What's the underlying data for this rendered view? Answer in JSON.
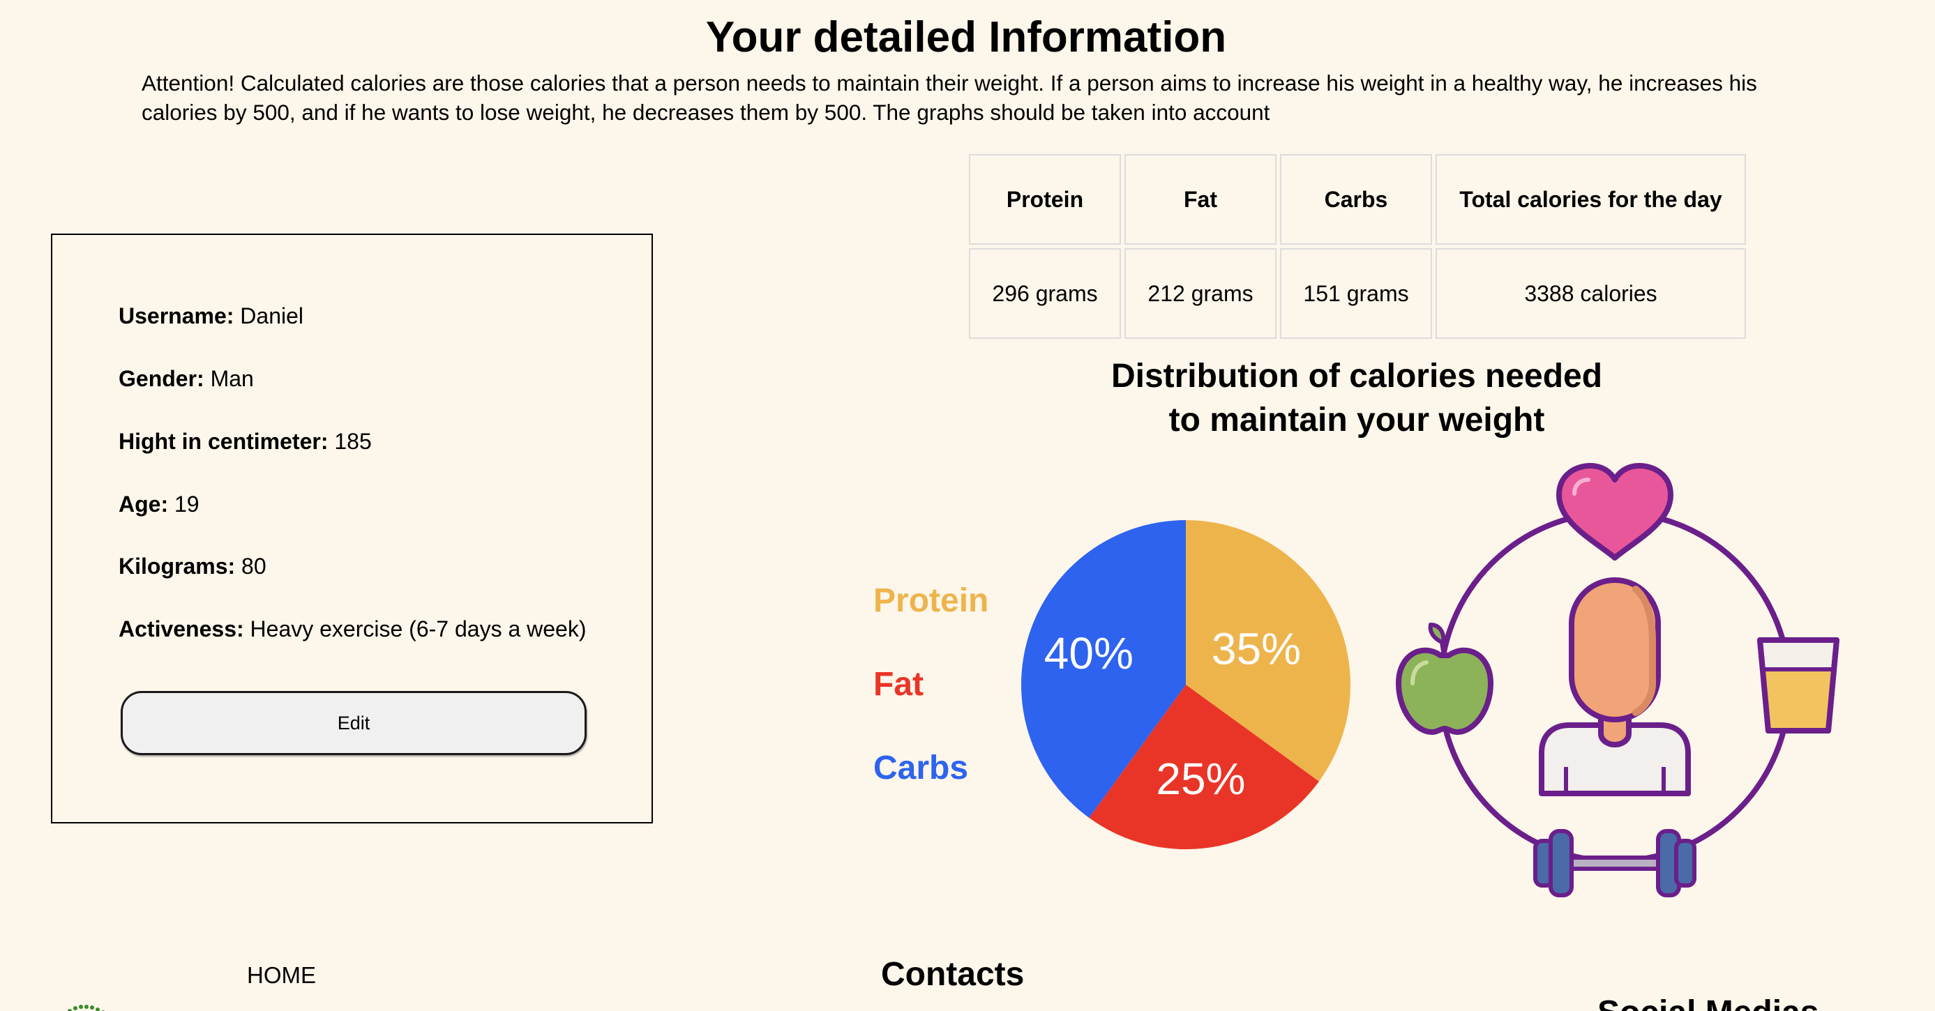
{
  "page": {
    "title": "Your detailed Information",
    "attention": "Attention! Calculated calories are those calories that a person needs to maintain their weight. If a person aims to increase his weight in a healthy way, he increases his calories by 500, and if he wants to lose weight, he decreases them by 500. The graphs should be taken into account"
  },
  "profile": {
    "rows": [
      {
        "label": "Username:",
        "value": "Daniel"
      },
      {
        "label": "Gender:",
        "value": "Man"
      },
      {
        "label": "Hight in centimeter:",
        "value": "185"
      },
      {
        "label": "Age:",
        "value": "19"
      },
      {
        "label": "Kilograms:",
        "value": "80"
      },
      {
        "label": "Activeness:",
        "value": "Heavy exercise (6-7 days a week)"
      }
    ],
    "edit_label": "Edit"
  },
  "macros": {
    "headers": [
      "Protein",
      "Fat",
      "Carbs",
      "Total calories for the day"
    ],
    "values": [
      "296 grams",
      "212 grams",
      "151 grams",
      "3388 calories"
    ]
  },
  "chart_data": {
    "type": "pie",
    "title": "Distribution of calories needed to maintain your weight",
    "title_lines": [
      "Distribution of calories needed",
      "to maintain your weight"
    ],
    "categories": [
      "Protein",
      "Fat",
      "Carbs"
    ],
    "values": [
      35,
      25,
      40
    ],
    "labels": [
      "35%",
      "25%",
      "40%"
    ],
    "colors": [
      "#eeb44c",
      "#e93527",
      "#2d63ee"
    ],
    "legend_position": "left"
  },
  "illustration": {
    "icons": [
      "heart-icon",
      "apple-icon",
      "person-icon",
      "juice-glass-icon",
      "dumbbell-icon"
    ],
    "colors": {
      "ring": "#6a1f8a",
      "heart": "#e8579a",
      "apple": "#8db35a",
      "skin": "#f0a478",
      "juice": "#f2c45f",
      "dumbbell": "#4a6aa8"
    }
  },
  "footer": {
    "home_label": "HOME",
    "contacts_title": "Contacts",
    "social_title": "Social Medias"
  }
}
